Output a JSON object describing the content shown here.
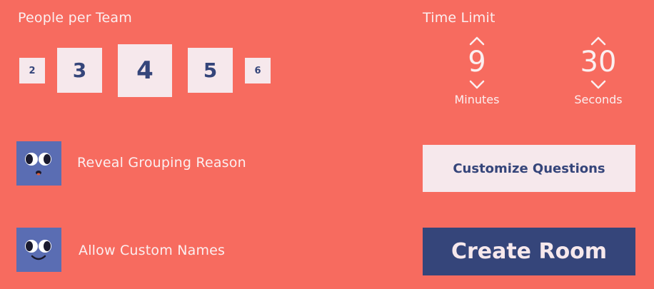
{
  "team_size": {
    "label": "People per Team",
    "options": [
      "2",
      "3",
      "4",
      "5",
      "6"
    ],
    "selected": "4"
  },
  "time_limit": {
    "label": "Time Limit",
    "minutes_value": "9",
    "minutes_unit": "Minutes",
    "seconds_value": "30",
    "seconds_unit": "Seconds"
  },
  "options": {
    "reveal_grouping_label": "Reveal Grouping Reason",
    "allow_custom_names_label": "Allow Custom Names"
  },
  "buttons": {
    "customize_label": "Customize Questions",
    "create_label": "Create Room"
  },
  "colors": {
    "background": "#f76b5f",
    "panel": "#f6e8ec",
    "accent": "#35457a",
    "toggle": "#5a6db3"
  }
}
